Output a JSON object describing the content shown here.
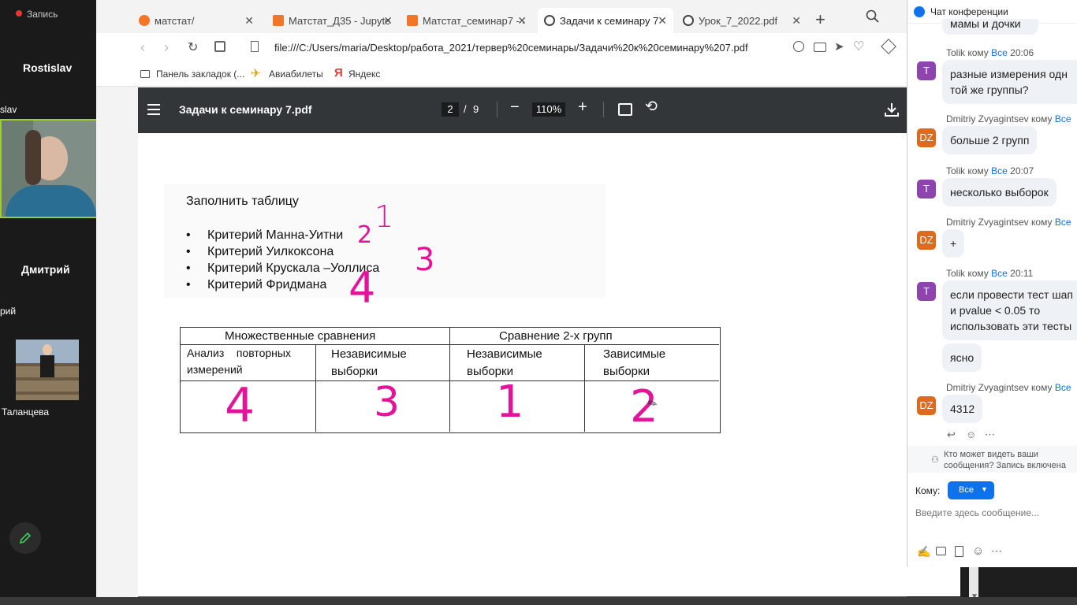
{
  "zoom": {
    "recording_label": "Запись",
    "participants": [
      {
        "name": "Rostislav",
        "sub": "slav"
      },
      {
        "name": "Дмитрий",
        "sub": "рий"
      },
      {
        "name": "",
        "sub": "Таланцева"
      }
    ]
  },
  "browser": {
    "tabs": [
      {
        "title": "матстат/"
      },
      {
        "title": "Матстат_Д35 - Jupyter"
      },
      {
        "title": "Матстат_семинар7 - J"
      },
      {
        "title": "Задачи к семинару 7.p"
      },
      {
        "title": "Урок_7_2022.pdf"
      }
    ],
    "url": "file:///C:/Users/maria/Desktop/работа_2021/тервер%20семинары/Задачи%20к%20семинару%207.pdf",
    "bookmarks": [
      "Панель закладок (...",
      "Авиабилеты",
      "Яндекс"
    ]
  },
  "pdf": {
    "title": "Задачи к семинару 7.pdf",
    "page_current": "2",
    "page_sep": "/",
    "page_total": "9",
    "zoom": "110%",
    "heading": "Заполнить таблицу",
    "bullets": [
      "Критерий Манна-Уитни",
      "Критерий Уилкоксона",
      "Критерий Крускала –Уоллиса",
      "Критерий Фридмана"
    ],
    "table": {
      "group1": "Множественные сравнения",
      "group2": "Сравнение 2-х групп",
      "col1a": "Анализ    повторных",
      "col1b": "измерений",
      "col2a": "Независимые",
      "col2b": "выборки",
      "col3a": "Независимые",
      "col3b": "выборки",
      "col4a": "Зависимые",
      "col4b": "выборки"
    },
    "handwritten": {
      "n1": "1",
      "n2": "2",
      "n3": "3",
      "n4": "4",
      "ans1": "4",
      "ans2": "3",
      "ans3": "1",
      "ans4": "2"
    }
  },
  "chat": {
    "title": "Чат конференции",
    "messages": [
      {
        "head_from": "Tolik",
        "head_mid": " кому ",
        "head_to": "Все",
        "time": " 20:06",
        "avatar": "T",
        "text": "разные измерения одн той же группы?"
      },
      {
        "head_from": "Dmitriy Zvyagintsev",
        "head_mid": " кому ",
        "head_to": "Все",
        "time": "",
        "avatar": "DZ",
        "text": "больше 2 групп"
      },
      {
        "head_from": "Tolik",
        "head_mid": " кому ",
        "head_to": "Все",
        "time": " 20:07",
        "avatar": "T",
        "text": "несколько выборок"
      },
      {
        "head_from": "Dmitriy Zvyagintsev",
        "head_mid": " кому ",
        "head_to": "Все",
        "time": "",
        "avatar": "DZ",
        "text": "+"
      },
      {
        "head_from": "Tolik",
        "head_mid": " кому ",
        "head_to": "Все",
        "time": " 20:11",
        "avatar": "T",
        "text": "если провести тест шап и pvalue < 0.05 то использовать эти тесты"
      },
      {
        "text": "ясно"
      },
      {
        "head_from": "Dmitriy Zvyagintsev",
        "head_mid": " кому ",
        "head_to": "Все",
        "time": "",
        "avatar": "DZ",
        "text": "4312"
      }
    ],
    "top_partial": "мамы и дочки",
    "who_can_see": "Кто может видеть ваши сообщения? Запись включена",
    "to_label": "Кому:",
    "to_value": "Все",
    "input_placeholder": "Введите здесь сообщение..."
  },
  "colors": {
    "ink": "#e3139a",
    "accent": "#0e72ed"
  }
}
